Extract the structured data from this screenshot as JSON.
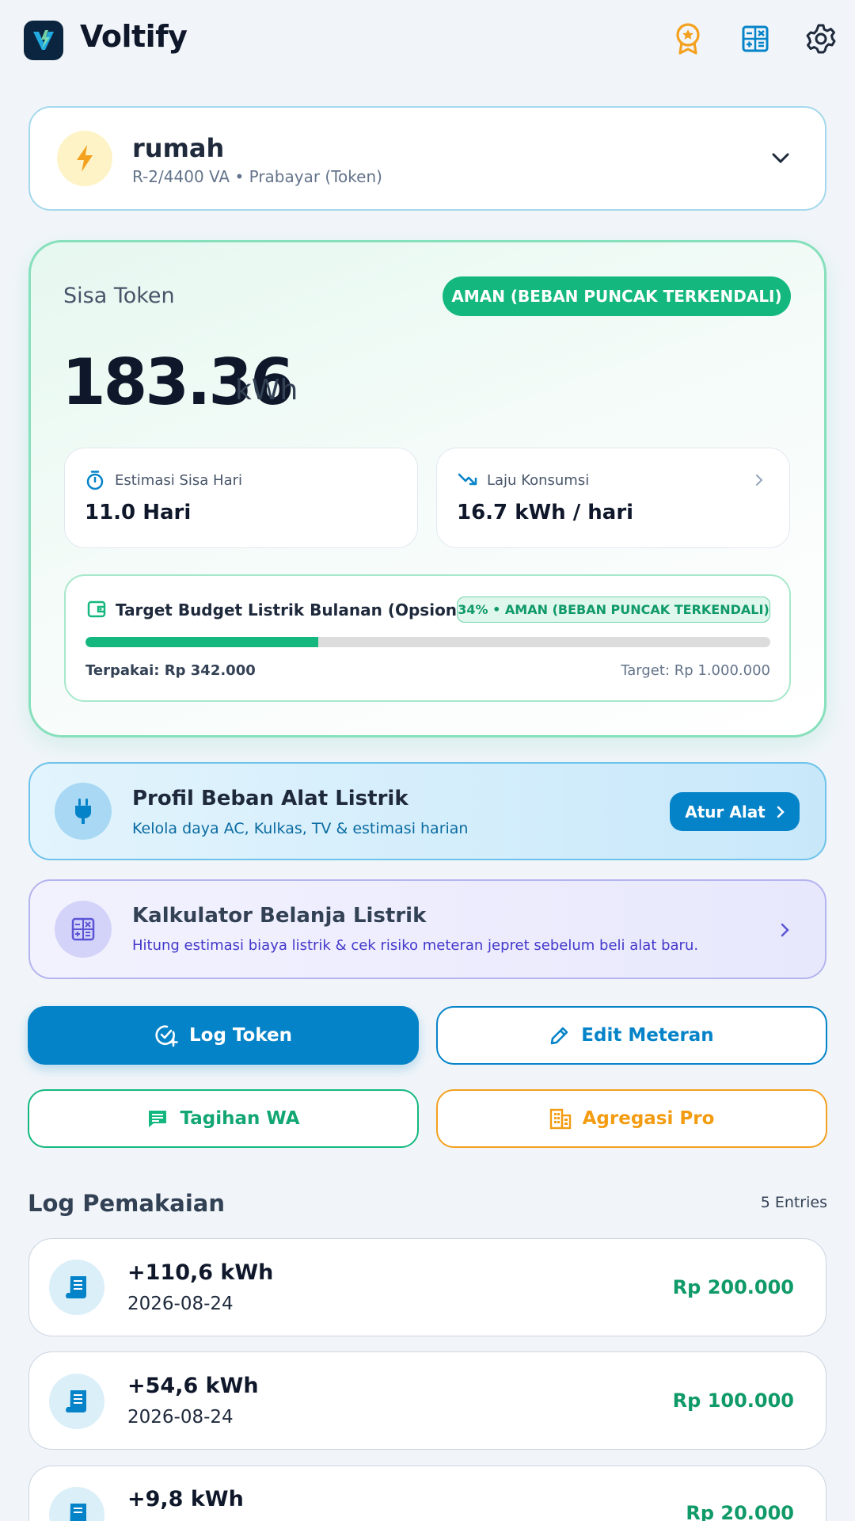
{
  "app": {
    "title": "Voltify"
  },
  "meter": {
    "name": "rumah",
    "subtitle": "R-2/4400 VA • Prabayar (Token)"
  },
  "token": {
    "label": "Sisa Token",
    "status": "AMAN (BEBAN PUNCAK TERKENDALI)",
    "value": "183.36",
    "unit": "kWh"
  },
  "stats": {
    "days_left": {
      "title": "Estimasi Sisa Hari",
      "value": "11.0 Hari"
    },
    "rate": {
      "title": "Laju Konsumsi",
      "value": "16.7 kWh / hari"
    }
  },
  "budget": {
    "title": "Target Budget Listrik Bulanan (Opsional)",
    "badge": "34% • AMAN (BEBAN PUNCAK TERKENDALI)",
    "progress_fraction": 0.34,
    "used": "Terpakai: Rp 342.000",
    "target": "Target: Rp 1.000.000"
  },
  "appliance": {
    "title": "Profil Beban Alat Listrik",
    "subtitle": "Kelola daya AC, Kulkas, TV & estimasi harian",
    "button": "Atur Alat"
  },
  "calculator": {
    "title": "Kalkulator Belanja Listrik",
    "subtitle": "Hitung estimasi biaya listrik & cek risiko meteran jepret sebelum beli alat baru."
  },
  "actions": {
    "log_token": "Log Token",
    "edit_meter": "Edit Meteran",
    "whatsapp": "Tagihan WA",
    "aggregate": "Agregasi Pro"
  },
  "log": {
    "title": "Log Pemakaian",
    "count": "5 Entries",
    "entries": [
      {
        "kwh": "+110,6 kWh",
        "date": "2026-08-24",
        "amount": "Rp 200.000"
      },
      {
        "kwh": "+54,6 kWh",
        "date": "2026-08-24",
        "amount": "Rp 100.000"
      },
      {
        "kwh": "+9,8 kWh",
        "date": "",
        "amount": "Rp 20.000"
      }
    ]
  },
  "colors": {
    "primary": "#0583c8",
    "success": "#14b87f",
    "warning": "#f39c12",
    "accent_indigo": "#4f46e5"
  }
}
